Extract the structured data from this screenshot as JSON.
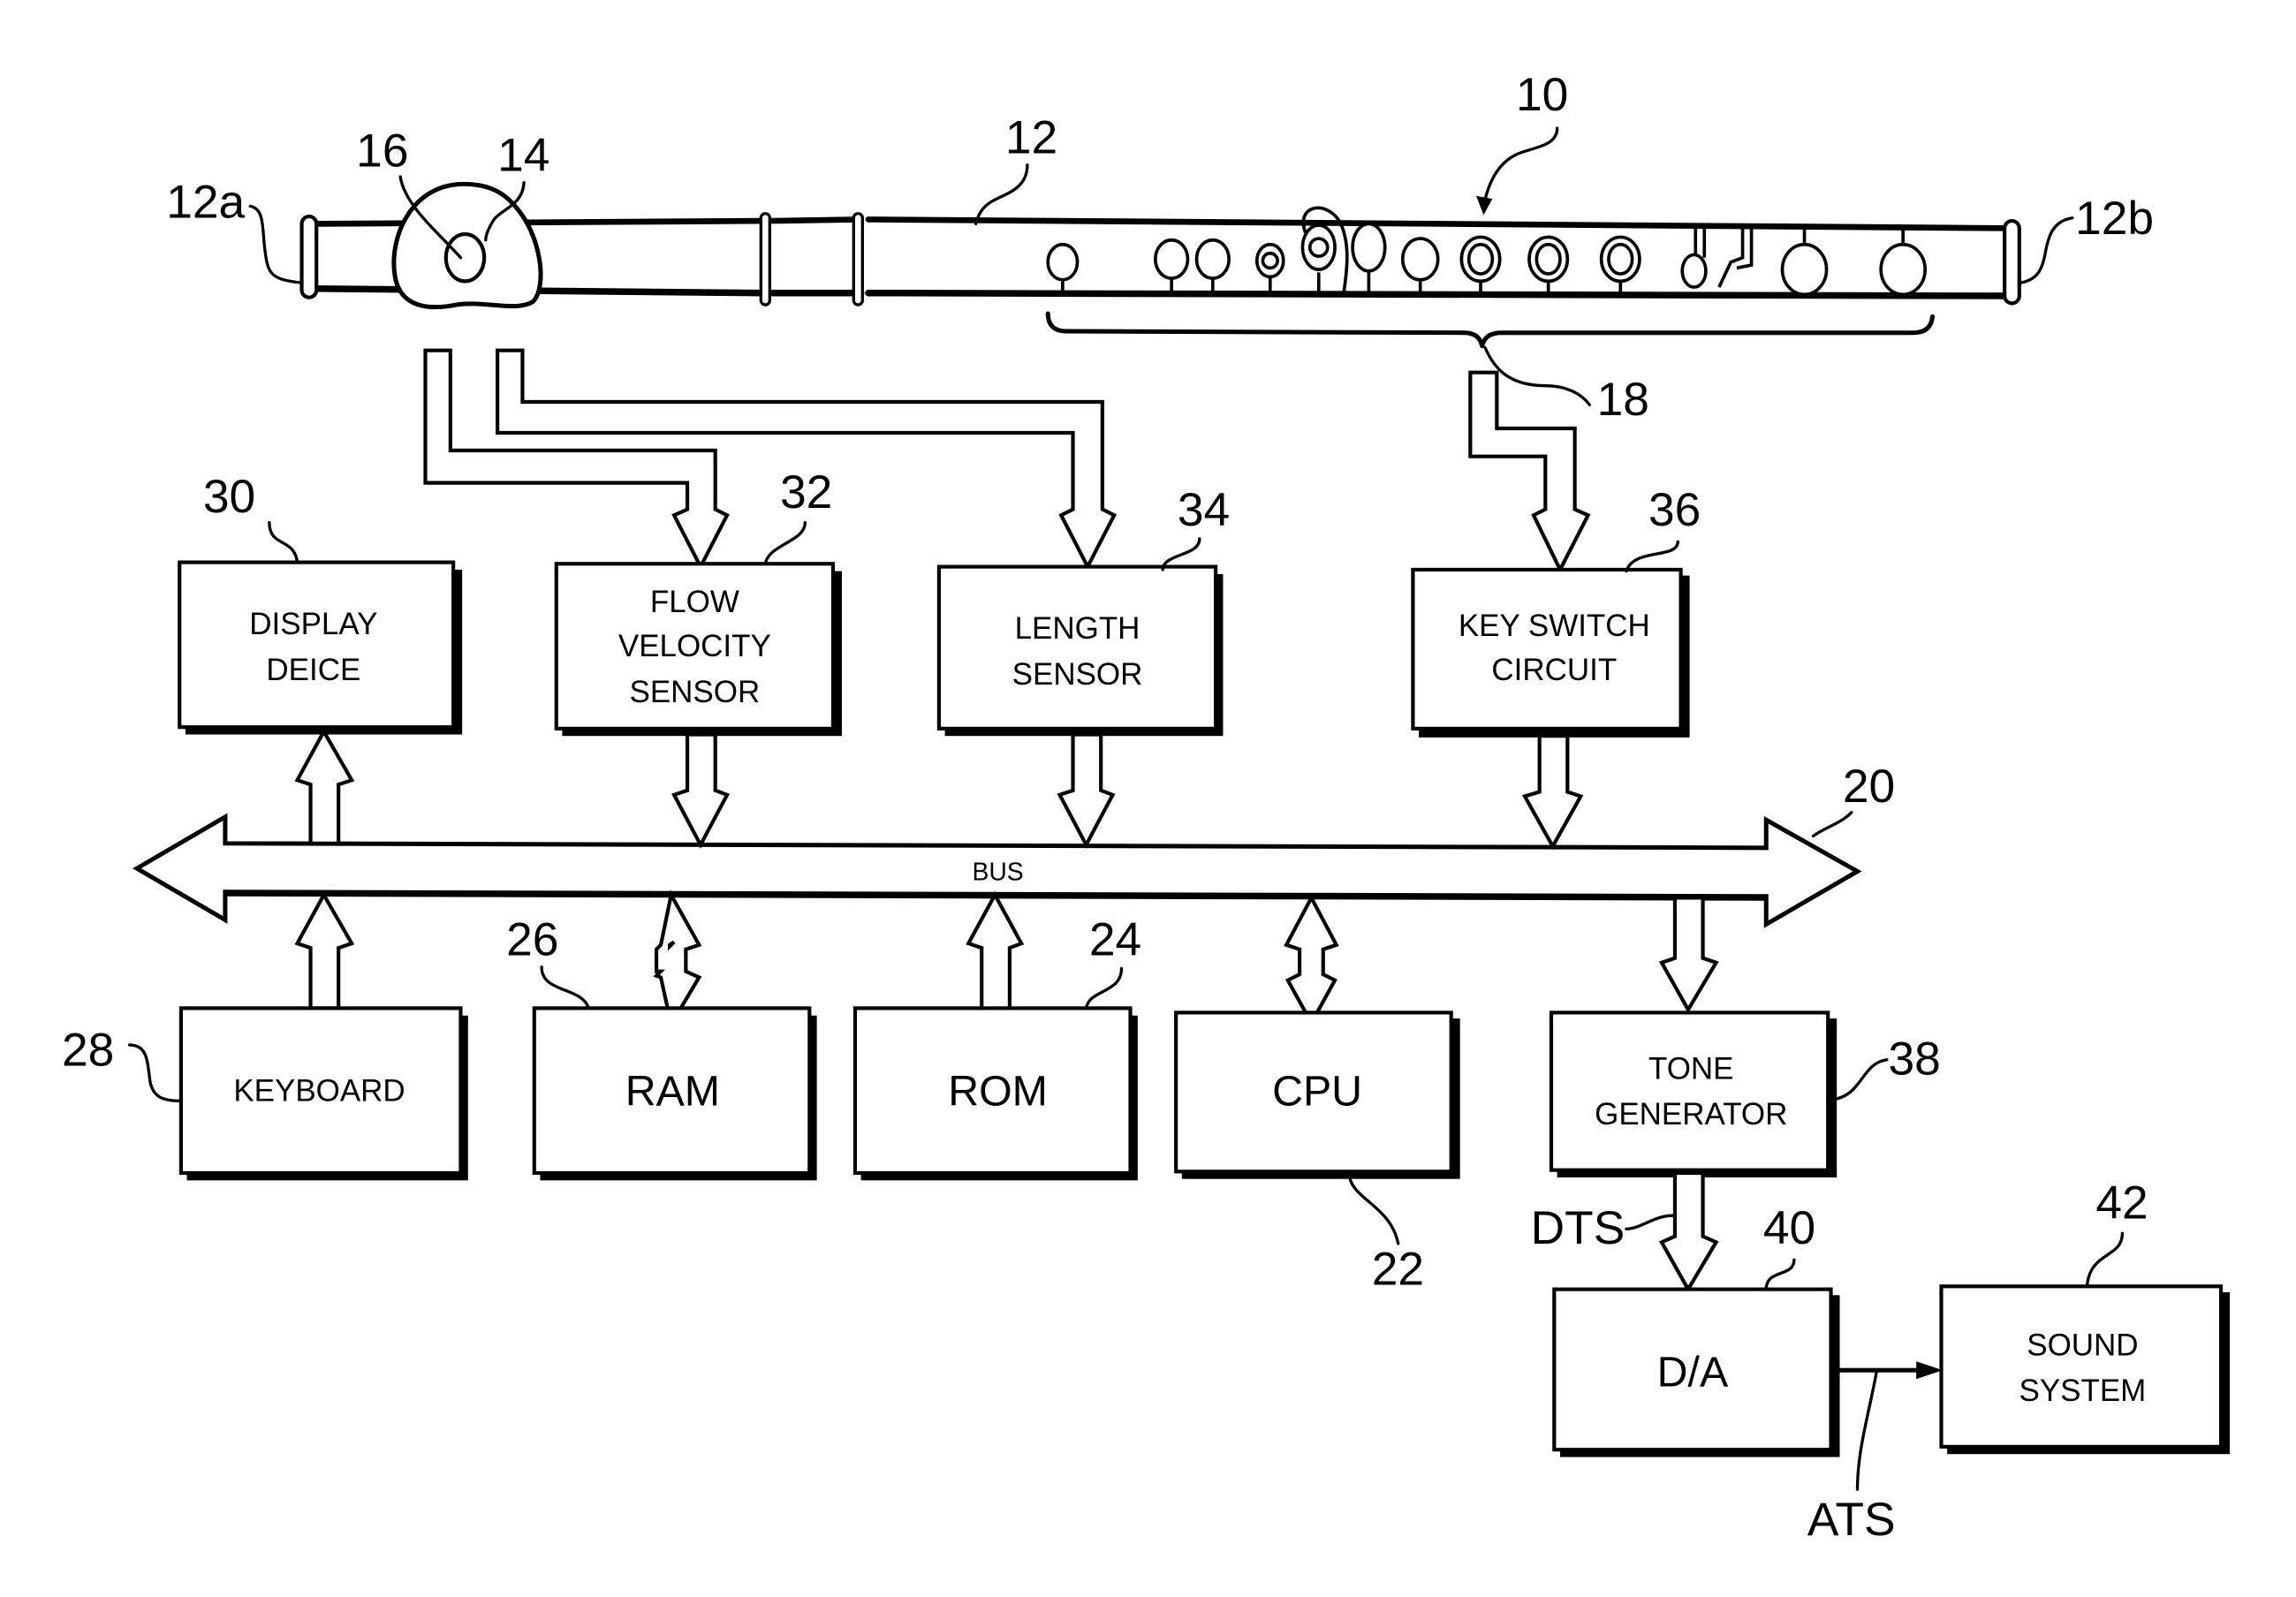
{
  "figure": {
    "instrument_ref": "10",
    "body_ref": "12",
    "end_left_ref": "12a",
    "end_right_ref": "12b",
    "mouthpiece_ref": "14",
    "embouchure_hole_ref": "16",
    "keys_ref": "18",
    "bus_ref": "20",
    "bus_label": "BUS"
  },
  "blocks": {
    "display": {
      "ref": "30",
      "lines": [
        "DISPLAY",
        "DEICE"
      ]
    },
    "flow": {
      "ref": "32",
      "lines": [
        "FLOW",
        "VELOCITY",
        "SENSOR"
      ]
    },
    "length": {
      "ref": "34",
      "lines": [
        "LENGTH",
        "SENSOR"
      ]
    },
    "keyswitch": {
      "ref": "36",
      "lines": [
        "KEY SWITCH",
        "CIRCUIT"
      ]
    },
    "keyboard": {
      "ref": "28",
      "label": "KEYBOARD"
    },
    "ram": {
      "ref": "26",
      "label": "RAM"
    },
    "rom": {
      "ref": "24",
      "label": "ROM"
    },
    "cpu": {
      "ref": "22",
      "label": "CPU"
    },
    "tone": {
      "ref": "38",
      "lines": [
        "TONE",
        "GENERATOR"
      ]
    },
    "da": {
      "ref": "40",
      "label": "D/A"
    },
    "sound": {
      "ref": "42",
      "lines": [
        "SOUND",
        "SYSTEM"
      ]
    }
  },
  "signals": {
    "digital": "DTS",
    "analog": "ATS"
  }
}
